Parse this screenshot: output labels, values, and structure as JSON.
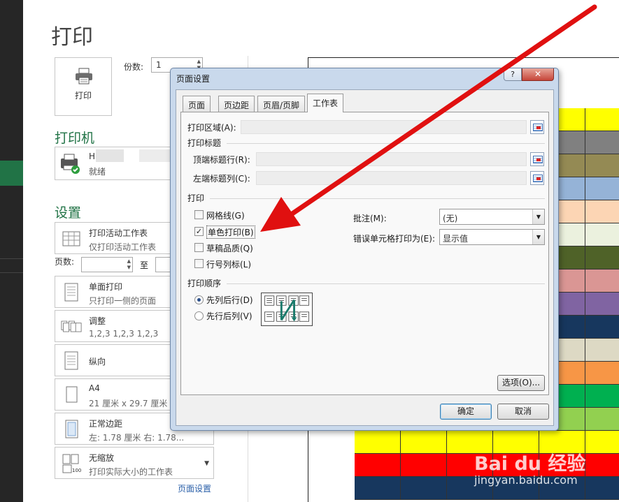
{
  "app": {
    "page_title": "打印"
  },
  "print": {
    "button_label": "打印",
    "copies_label": "份数:",
    "copies_value": "1"
  },
  "printer": {
    "section_title": "打印机",
    "name": "H",
    "status": "就绪"
  },
  "settings": {
    "section_title": "设置",
    "items": [
      {
        "title": "打印活动工作表",
        "subtitle": "仅打印活动工作表"
      },
      {
        "title": "单面打印",
        "subtitle": "只打印一侧的页面"
      },
      {
        "title": "调整",
        "subtitle": "1,2,3    1,2,3    1,2,3"
      },
      {
        "title": "纵向",
        "subtitle": ""
      },
      {
        "title": "A4",
        "subtitle": "21 厘米 x 29.7 厘米"
      },
      {
        "title": "正常边距",
        "subtitle": "左: 1.78 厘米    右: 1.78..."
      },
      {
        "title": "无缩放",
        "subtitle": "打印实际大小的工作表"
      }
    ],
    "pages_label": "页数:",
    "pages_to": "至",
    "page_setup_link": "页面设置"
  },
  "dialog": {
    "title": "页面设置",
    "help": "?",
    "close": "✕",
    "tabs": [
      "页面",
      "页边距",
      "页眉/页脚",
      "工作表"
    ],
    "active_tab": "工作表",
    "print_area_label": "打印区域(A):",
    "print_titles_group": "打印标题",
    "rows_to_repeat_label": "顶端标题行(R):",
    "cols_to_repeat_label": "左端标题列(C):",
    "print_group": "打印",
    "gridlines_label": "网格线(G)",
    "gridlines_checked": false,
    "bw_label": "单色打印(B)",
    "bw_checked": true,
    "draft_label": "草稿品质(Q)",
    "draft_checked": false,
    "headings_label": "行号列标(L)",
    "headings_checked": false,
    "comments_label": "批注(M):",
    "comments_value": "(无)",
    "errors_label": "错误单元格打印为(E):",
    "errors_value": "显示值",
    "order_group": "打印顺序",
    "order_down_label": "先列后行(D)",
    "order_over_label": "先行后列(V)",
    "order_selected": "down",
    "options_button": "选项(O)...",
    "ok_button": "确定",
    "cancel_button": "取消"
  },
  "preview": {
    "colors": {
      "yellow": "#ffff00",
      "gray": "#808080",
      "olive": "#948a54",
      "lightblue": "#95b3d7",
      "peach": "#fcd5b4",
      "pale": "#ebf1de",
      "darkolive": "#4f6228",
      "rose": "#da9694",
      "purple": "#8064a2",
      "navy": "#17375e",
      "beige": "#ddd9c4",
      "orange": "#f79646",
      "green": "#00b050",
      "lightgreen": "#92d050",
      "red": "#ff0000"
    }
  },
  "watermark": {
    "brand": "Bai du 经验",
    "url": "jingyan.baidu.com"
  }
}
